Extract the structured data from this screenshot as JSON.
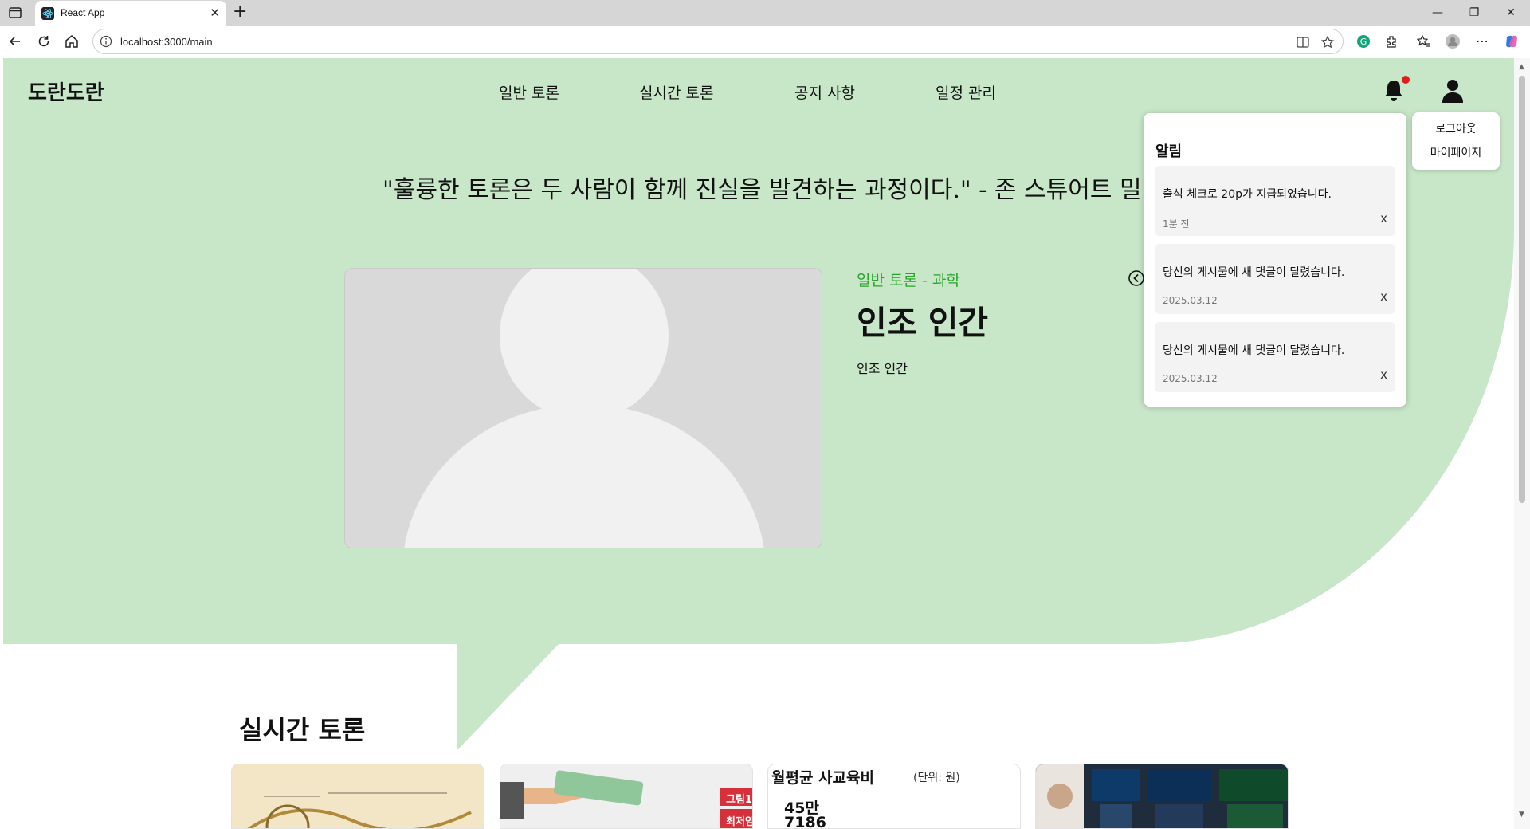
{
  "browser": {
    "tab_title": "React App",
    "url": "localhost:3000/main"
  },
  "site": {
    "logo": "도란도란",
    "nav": [
      {
        "label": "일반 토론"
      },
      {
        "label": "실시간 토론"
      },
      {
        "label": "공지 사항"
      },
      {
        "label": "일정 관리"
      }
    ],
    "user_menu": {
      "logout": "로그아웃",
      "mypage": "마이페이지"
    }
  },
  "hero": {
    "quote": "\"훌륭한 토론은 두 사람이 함께 진실을 발견하는 과정이다.\" - 존 스튜어트 밀",
    "card": {
      "category": "일반 토론 - 과학",
      "title": "인조 인간",
      "description": "인조 인간"
    }
  },
  "notifications": {
    "title": "알림",
    "items": [
      {
        "message": "출석 체크로 20p가 지급되었습니다.",
        "time": "1분 전",
        "close": "x"
      },
      {
        "message": "당신의 게시물에 새 댓글이 달렸습니다.",
        "time": "2025.03.12",
        "close": "x"
      },
      {
        "message": "당신의 게시물에 새 댓글이 달렸습니다.",
        "time": "2025.03.12",
        "close": "x"
      }
    ]
  },
  "realtime": {
    "title": "실시간 토론",
    "thumb3": {
      "heading": "월평균 사교육비",
      "unit": "(단위: 원)",
      "value_line1": "45만",
      "value_line2": "7186"
    },
    "thumb2": {
      "tag1": "그림1",
      "tag2": "최저임"
    }
  },
  "colors": {
    "hero_bg": "#c8e6c8",
    "category_green": "#2aa52a",
    "notification_dot": "#e41b1b"
  }
}
